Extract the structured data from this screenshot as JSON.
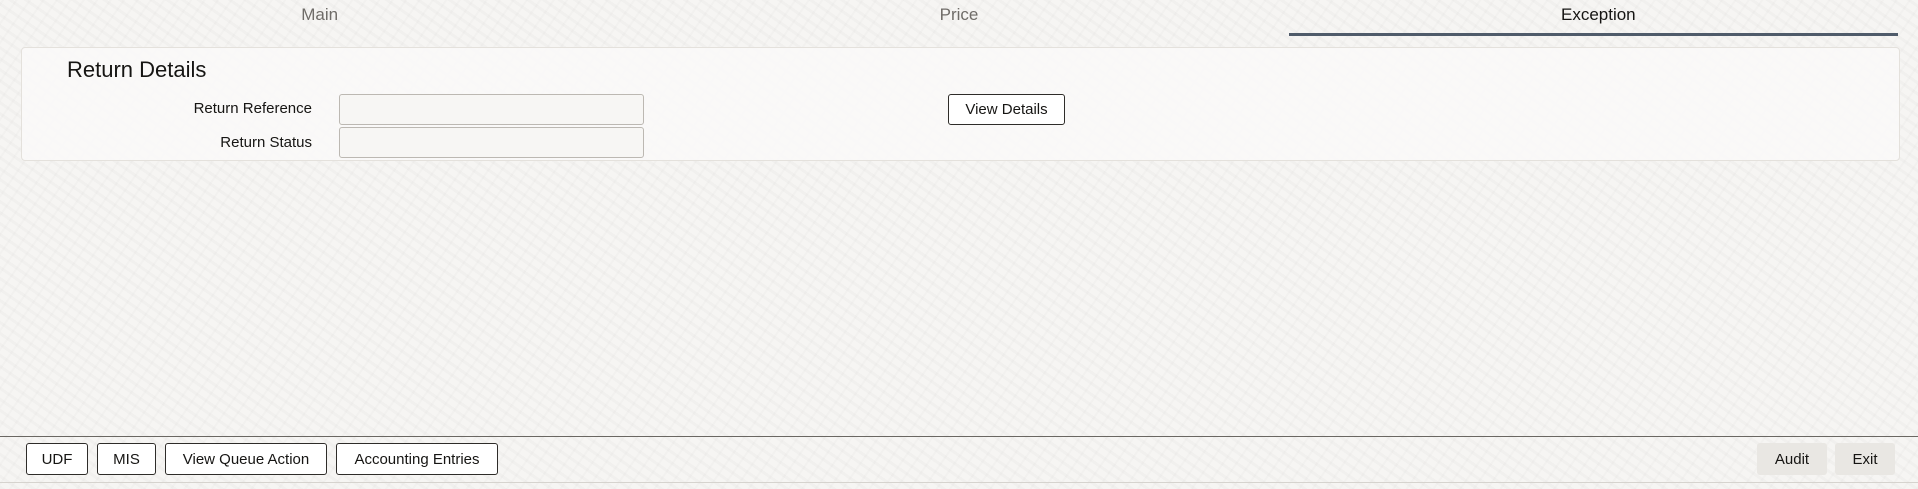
{
  "tabs": [
    {
      "label": "Main"
    },
    {
      "label": "Price"
    },
    {
      "label": "Exception"
    }
  ],
  "active_tab": "Exception",
  "section": {
    "title": "Return Details",
    "fields": {
      "return_reference": {
        "label": "Return Reference",
        "value": ""
      },
      "return_status": {
        "label": "Return Status",
        "value": ""
      }
    },
    "view_details_label": "View Details"
  },
  "footer": {
    "left_buttons": [
      {
        "label": "UDF"
      },
      {
        "label": "MIS"
      },
      {
        "label": "View Queue Action"
      },
      {
        "label": "Accounting Entries"
      }
    ],
    "audit_label": "Audit",
    "exit_label": "Exit"
  },
  "colors": {
    "active_tab_underline": "#4f5b6a",
    "background": "#f6f5f3",
    "text": "#161513"
  }
}
